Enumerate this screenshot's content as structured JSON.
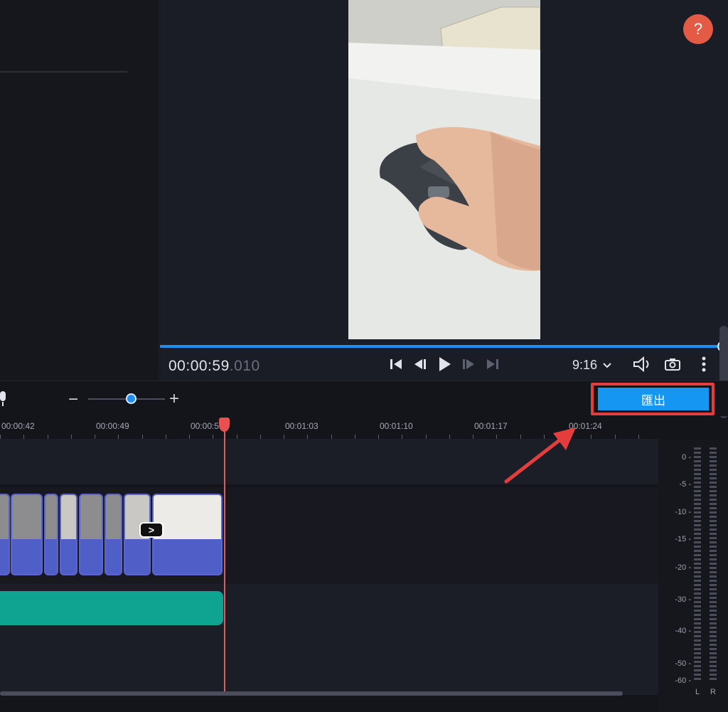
{
  "preview": {
    "timecode_main": "00:00:59",
    "timecode_ms": ".010",
    "aspect_ratio": "9:16",
    "progress_fraction": 0.99,
    "help_label": "?"
  },
  "toolbar": {
    "zoom_minus": "−",
    "zoom_plus": "+",
    "export_label": "匯出",
    "zoom_fraction": 0.5
  },
  "ruler": {
    "labels": [
      "00:00:42",
      "00:00:49",
      "00:00:5",
      "00:01:03",
      "00:01:10",
      "00:01:17",
      "00:01:24"
    ]
  },
  "meter": {
    "scale": [
      "0",
      "-5",
      "-10",
      "-15",
      "-20",
      "-30",
      "-40",
      "-50",
      "-60"
    ],
    "left_label": "L",
    "right_label": "R"
  },
  "icons": {
    "help": "help-icon",
    "skip_start": "skip-to-start-icon",
    "step_back": "frame-back-icon",
    "play": "play-icon",
    "step_forward": "frame-forward-icon",
    "skip_end": "skip-to-end-icon",
    "volume": "volume-icon",
    "snapshot": "camera-icon",
    "more": "more-vertical-icon",
    "mic": "microphone-icon"
  },
  "colors": {
    "accent": "#1496f2",
    "playhead": "#e85151",
    "audio_clip": "#0fa391",
    "video_clip": "#4f5fc7",
    "highlight": "#e43d3d"
  }
}
